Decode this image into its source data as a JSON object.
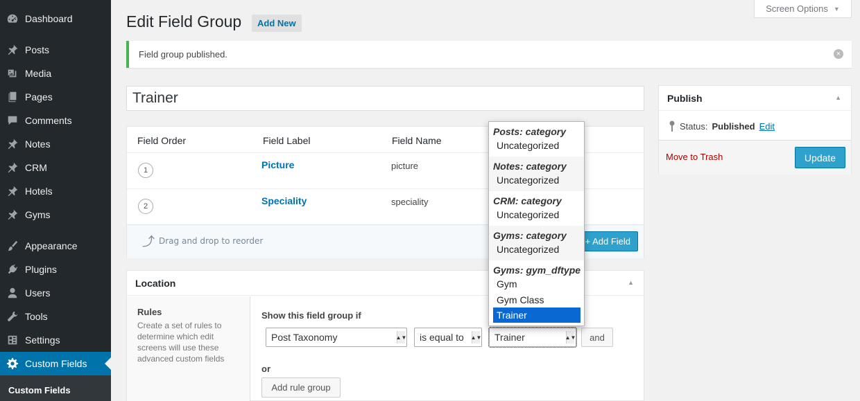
{
  "sidebar": {
    "items": [
      {
        "label": "Dashboard",
        "icon": "dashboard-icon"
      },
      {
        "label": "Posts",
        "icon": "pin-icon"
      },
      {
        "label": "Media",
        "icon": "media-icon"
      },
      {
        "label": "Pages",
        "icon": "pages-icon"
      },
      {
        "label": "Comments",
        "icon": "comments-icon"
      },
      {
        "label": "Notes",
        "icon": "pin-icon"
      },
      {
        "label": "CRM",
        "icon": "pin-icon"
      },
      {
        "label": "Hotels",
        "icon": "pin-icon"
      },
      {
        "label": "Gyms",
        "icon": "pin-icon"
      },
      {
        "label": "Appearance",
        "icon": "brush-icon"
      },
      {
        "label": "Plugins",
        "icon": "plug-icon"
      },
      {
        "label": "Users",
        "icon": "user-icon"
      },
      {
        "label": "Tools",
        "icon": "wrench-icon"
      },
      {
        "label": "Settings",
        "icon": "settings-icon"
      },
      {
        "label": "Custom Fields",
        "icon": "gear-icon"
      }
    ],
    "submenu_label": "Custom Fields"
  },
  "header": {
    "title": "Edit Field Group",
    "add_new": "Add New",
    "screen_options": "Screen Options"
  },
  "notice": {
    "text": "Field group published."
  },
  "title_value": "Trainer",
  "fields_table": {
    "headers": [
      "Field Order",
      "Field Label",
      "Field Name"
    ],
    "rows": [
      {
        "order": "1",
        "label": "Picture",
        "name": "picture"
      },
      {
        "order": "2",
        "label": "Speciality",
        "name": "speciality"
      }
    ],
    "drag_note": "Drag and drop to reorder",
    "add_field": "+ Add Field"
  },
  "location": {
    "title": "Location",
    "rules_title": "Rules",
    "rules_desc": "Create a set of rules to determine which edit screens will use these advanced custom fields",
    "show_if": "Show this field group if",
    "param": "Post Taxonomy",
    "operator": "is equal to",
    "value": "Trainer",
    "and": "and",
    "or": "or",
    "add_rule_group": "Add rule group"
  },
  "dropdown": {
    "groups": [
      {
        "label": "Posts: category",
        "options": [
          "Uncategorized"
        ]
      },
      {
        "label": "Notes: category",
        "options": [
          "Uncategorized"
        ]
      },
      {
        "label": "CRM: category",
        "options": [
          "Uncategorized"
        ]
      },
      {
        "label": "Gyms: category",
        "options": [
          "Uncategorized"
        ]
      },
      {
        "label": "Gyms: gym_dftype",
        "options": [
          "Gym",
          "Gym Class",
          "Trainer"
        ]
      }
    ],
    "selected": "Trainer"
  },
  "publish": {
    "title": "Publish",
    "status_label": "Status:",
    "status_value": "Published",
    "edit": "Edit",
    "trash": "Move to Trash",
    "update": "Update"
  }
}
